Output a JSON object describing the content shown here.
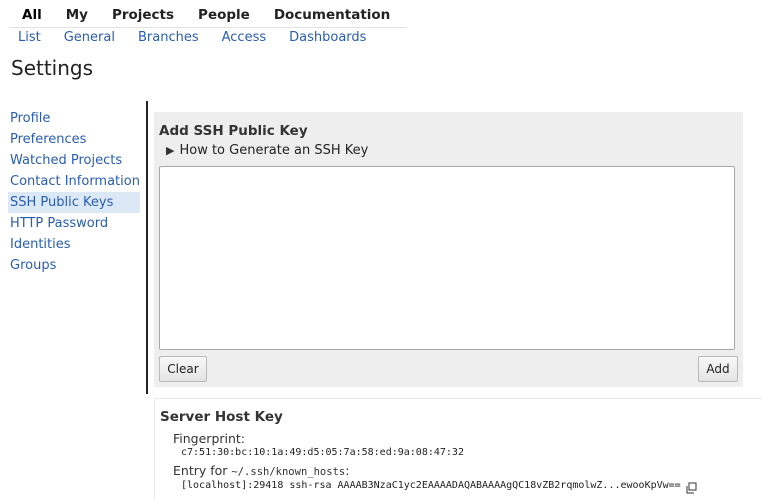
{
  "top_menu": [
    "All",
    "My",
    "Projects",
    "People",
    "Documentation"
  ],
  "sub_menu": [
    "List",
    "General",
    "Branches",
    "Access",
    "Dashboards"
  ],
  "page_title": "Settings",
  "sidebar": {
    "items": [
      {
        "label": "Profile"
      },
      {
        "label": "Preferences"
      },
      {
        "label": "Watched Projects"
      },
      {
        "label": "Contact Information"
      },
      {
        "label": "SSH Public Keys"
      },
      {
        "label": "HTTP Password"
      },
      {
        "label": "Identities"
      },
      {
        "label": "Groups"
      }
    ],
    "active": "SSH Public Keys"
  },
  "add_key": {
    "title": "Add SSH Public Key",
    "howto_label": "How to Generate an SSH Key",
    "key_value": "",
    "clear_label": "Clear",
    "add_label": "Add"
  },
  "host_key": {
    "title": "Server Host Key",
    "fingerprint_label": "Fingerprint:",
    "fingerprint": "c7:51:30:bc:10:1a:49:d5:05:7a:58:ed:9a:08:47:32",
    "entry_label": "Entry for",
    "entry_file": "~/.ssh/known_hosts",
    "entry_suffix": ":",
    "entry": "[localhost]:29418 ssh-rsa AAAAB3NzaC1yc2EAAAADAQABAAAAgQC18vZB2rqmolwZ...ewooKpVw==",
    "copy_icon": "copy-icon"
  },
  "colors": {
    "link": "#2a5db0",
    "active_bg": "#dbe9f7",
    "panel_bg": "#eeeeee"
  }
}
